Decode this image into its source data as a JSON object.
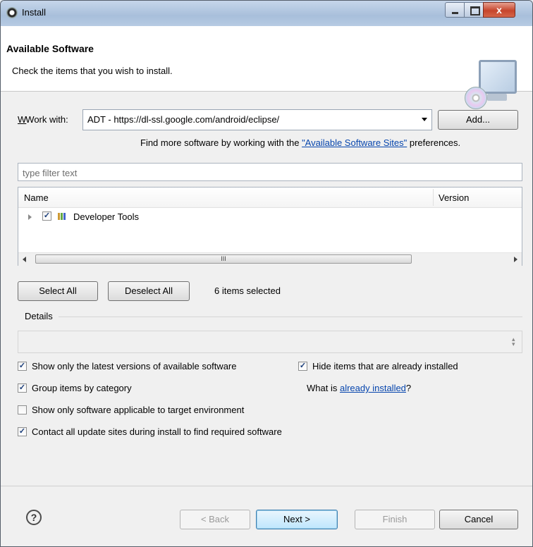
{
  "window": {
    "title": "Install",
    "close_glyph": "x"
  },
  "banner": {
    "heading": "Available Software",
    "subtitle": "Check the items that you wish to install.",
    "icon": "monitor-cd-icon"
  },
  "work_with": {
    "label": "Work with:",
    "value": "ADT - https://dl-ssl.google.com/android/eclipse/",
    "add_label": "Add...",
    "hint_prefix": "Find more software by working with the",
    "hint_link": "\"Available Software Sites\"",
    "hint_suffix": "preferences."
  },
  "filter": {
    "placeholder": "type filter text"
  },
  "tree": {
    "columns": [
      "Name",
      "Version"
    ],
    "items": [
      {
        "label": "Developer Tools",
        "checked": true,
        "version": ""
      }
    ],
    "scrollbar_glyph": "III"
  },
  "selection": {
    "select_all": "Select All",
    "deselect_all": "Deselect All",
    "count_text": "6 items selected"
  },
  "details": {
    "label": "Details"
  },
  "options": {
    "latest_only": {
      "label": "Show only the latest versions of available software",
      "checked": true
    },
    "hide_installed": {
      "label": "Hide items that are already installed",
      "checked": true
    },
    "group_by_category": {
      "label": "Group items by category",
      "checked": true
    },
    "what_is_prefix": "What is",
    "what_is_link": "already installed",
    "what_is_suffix": "?",
    "target_env": {
      "label": "Show only software applicable to target environment",
      "checked": false
    },
    "contact_sites": {
      "label": "Contact all update sites during install to find required software",
      "checked": true
    }
  },
  "footer": {
    "help": "?",
    "back": "< Back",
    "next": "Next >",
    "finish": "Finish",
    "cancel": "Cancel"
  }
}
